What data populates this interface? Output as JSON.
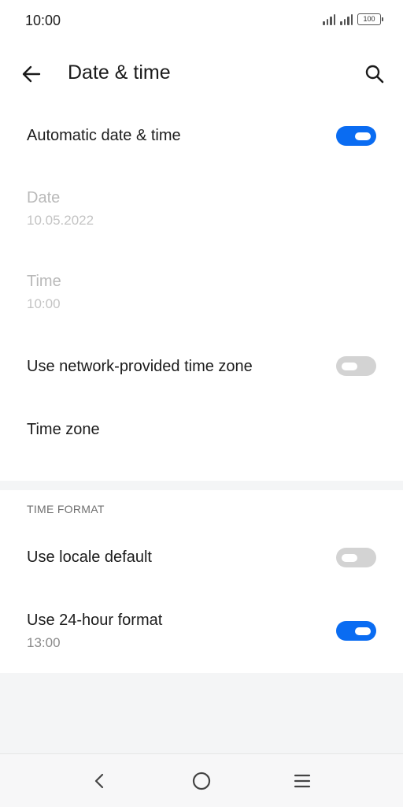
{
  "status_bar": {
    "time": "10:00",
    "battery": "100",
    "icons": [
      "signal-icon",
      "signal-icon",
      "battery-icon"
    ]
  },
  "header": {
    "title": "Date & time",
    "back_icon": "back-arrow-icon",
    "search_icon": "search-icon"
  },
  "settings": {
    "automatic": {
      "title": "Automatic date & time",
      "enabled": true
    },
    "date": {
      "title": "Date",
      "value": "10.05.2022",
      "disabled": true
    },
    "time": {
      "title": "Time",
      "value": "10:00",
      "disabled": true
    },
    "network_zone": {
      "title": "Use network-provided time zone",
      "enabled": false
    },
    "time_zone": {
      "title": "Time zone"
    }
  },
  "time_format": {
    "header": "TIME FORMAT",
    "locale_default": {
      "title": "Use locale default",
      "enabled": false
    },
    "hour24": {
      "title": "Use 24-hour format",
      "subtitle": "13:00",
      "enabled": true
    }
  },
  "nav_bar": {
    "icons": [
      "nav-back-icon",
      "nav-home-icon",
      "nav-menu-icon"
    ]
  },
  "colors": {
    "accent": "#0a6cf2",
    "toggle_off": "#d3d3d3",
    "disabled_text": "#b9b9b9"
  }
}
